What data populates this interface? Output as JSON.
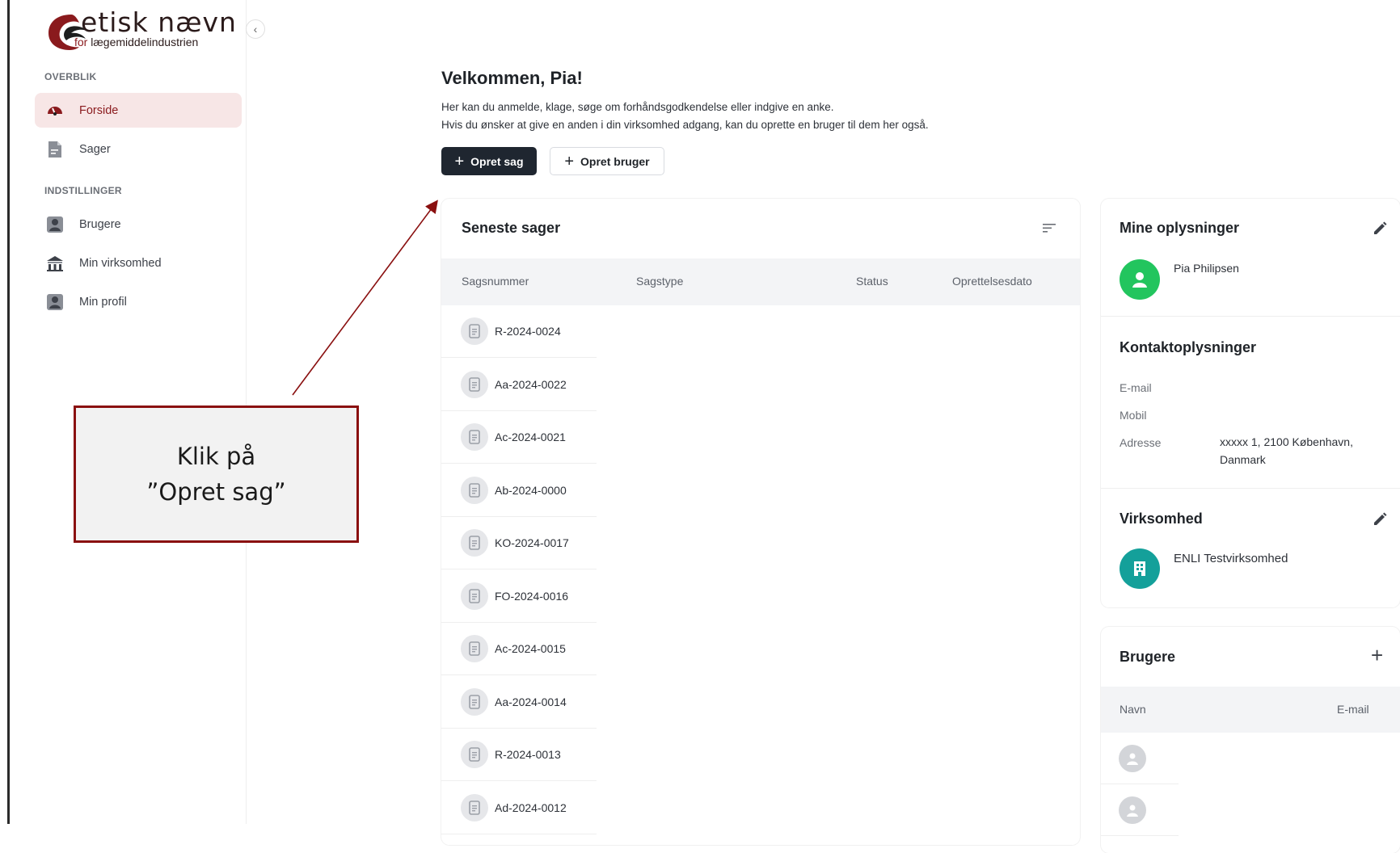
{
  "logo": {
    "main": "etisk nævn",
    "sub_prefix": "for ",
    "sub_rest": "lægemiddelindustrien"
  },
  "sidebar": {
    "section_overview": "OVERBLIK",
    "section_settings": "INDSTILLINGER",
    "items": [
      {
        "label": "Forside",
        "icon": "dashboard-gauge-icon",
        "active": true
      },
      {
        "label": "Sager",
        "icon": "document-icon"
      },
      {
        "label": "Brugere",
        "icon": "user-badge-icon"
      },
      {
        "label": "Min virksomhed",
        "icon": "building-icon"
      },
      {
        "label": "Min profil",
        "icon": "user-badge-icon"
      }
    ]
  },
  "main": {
    "welcome": "Velkommen, Pia!",
    "intro_line1": "Her kan du anmelde, klage, søge om forhåndsgodkendelse eller indgive en anke.",
    "intro_line2": "Hvis du ønsker at give en anden i din virksomhed adgang, kan du oprette en bruger til dem her også.",
    "create_case_label": "Opret sag",
    "create_user_label": "Opret bruger"
  },
  "cases": {
    "title": "Seneste sager",
    "columns": [
      "Sagsnummer",
      "Sagstype",
      "Status",
      "Oprettelsesdato"
    ],
    "rows": [
      "R-2024-0024",
      "Aa-2024-0022",
      "Ac-2024-0021",
      "Ab-2024-0000",
      "KO-2024-0017",
      "FO-2024-0016",
      "Ac-2024-0015",
      "Aa-2024-0014",
      "R-2024-0013",
      "Ad-2024-0012"
    ]
  },
  "profile": {
    "title": "Mine oplysninger",
    "name": "Pia Philipsen",
    "contact_title": "Kontaktoplysninger",
    "email_label": "E-mail",
    "mobile_label": "Mobil",
    "address_label": "Adresse",
    "address_line1": "xxxxx 1, 2100 København,",
    "address_line2": "Danmark",
    "company_title": "Virksomhed",
    "company_name": "ENLI Testvirksomhed"
  },
  "users": {
    "title": "Brugere",
    "col_name": "Navn",
    "col_email": "E-mail"
  },
  "callout": {
    "line1": "Klik på",
    "line2": "”Opret sag”"
  },
  "colors": {
    "accent": "#8a1a1d",
    "primary_button": "#1f2630",
    "green_avatar": "#22c55e",
    "teal_avatar": "#14a09a"
  }
}
